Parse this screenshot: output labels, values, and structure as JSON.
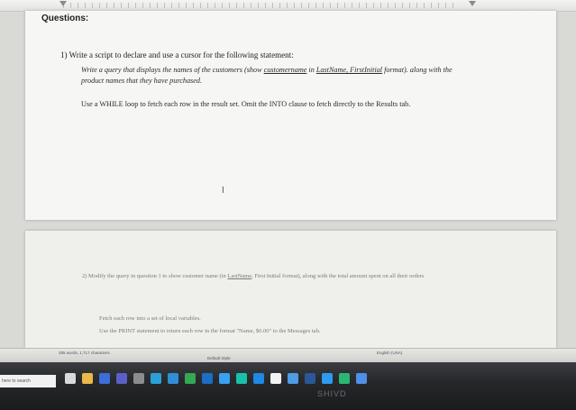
{
  "document": {
    "heading": "Questions:",
    "question1": {
      "text": "1)  Write a script to declare and use a cursor for the following statement:",
      "paragraph1_pre": "Write a query that displays the names of the customers (show ",
      "paragraph1_u1": "customername",
      "paragraph1_mid": " in ",
      "paragraph1_u2": "LastName, FirstInitial",
      "paragraph1_post": " format). along with the product names that they have purchased.",
      "paragraph2": "Use a WHILE loop to fetch each row in the result set. Omit the INTO clause to fetch directly to the Results tab."
    },
    "cursor_glyph": "I",
    "question2": {
      "line1_pre": "2)  Modify the query in question 1 to show customer name (in ",
      "line1_u": "LastName",
      "line1_post": ", First Initial format), along with the total amount spent on all their orders",
      "paragraph1": "Fetch each row into a set of local variables.",
      "paragraph2": "Use the PRINT statement to return each row in the format \"Name, $0.00\" to the Messages tab."
    }
  },
  "status_bar": {
    "word_count": "285 words, 1,717 characters",
    "style": "Default Style",
    "language": "English (USA)"
  },
  "taskbar": {
    "search_placeholder": "here to search",
    "brand_text": "SHIVD",
    "icons": [
      {
        "name": "task-view-icon",
        "color": "#d9d9d9"
      },
      {
        "name": "file-explorer-icon",
        "color": "#e9b949"
      },
      {
        "name": "media-icon",
        "color": "#3c6ed8"
      },
      {
        "name": "teams-icon",
        "color": "#5b5fc7"
      },
      {
        "name": "settings-icon",
        "color": "#8c8c8c"
      },
      {
        "name": "maps-icon",
        "color": "#2aa0d8"
      },
      {
        "name": "edge-icon",
        "color": "#2f8fd6"
      },
      {
        "name": "chrome-icon",
        "color": "#34a853"
      },
      {
        "name": "mail-icon",
        "color": "#1b6ec2"
      },
      {
        "name": "dev-icon",
        "color": "#3aa0f0"
      },
      {
        "name": "app-icon",
        "color": "#19c1a9"
      },
      {
        "name": "store-icon",
        "color": "#1e88e5"
      },
      {
        "name": "camera-icon",
        "color": "#f2f2f2"
      },
      {
        "name": "photos-icon",
        "color": "#4e9be6"
      },
      {
        "name": "word-icon",
        "color": "#2b5797"
      },
      {
        "name": "vscode-icon",
        "color": "#2d9bf0"
      },
      {
        "name": "edit-icon",
        "color": "#2bb673"
      },
      {
        "name": "docs-icon",
        "color": "#4f8fe8"
      }
    ]
  }
}
